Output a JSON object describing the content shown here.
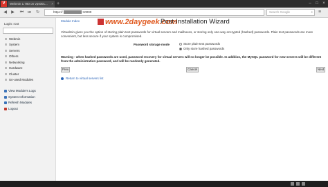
{
  "browser": {
    "tab_title": "Webmin 1.780 on vps001...",
    "tab_close": "×",
    "new_tab": "+",
    "address_prefix": "https://",
    "address_suffix": ":10000",
    "search_placeholder": "Search Google",
    "min_label": "–",
    "max_label": "□",
    "close_label": "×"
  },
  "sidebar": {
    "login": "Login: root",
    "nav": [
      "Webmin",
      "System",
      "Servers",
      "Others",
      "Networking",
      "Hardware",
      "Cluster",
      "Un-used Modules"
    ],
    "actions": [
      {
        "label": "View Module's Logs",
        "color": "#3b73b9"
      },
      {
        "label": "System Information",
        "color": "#3b73b9"
      },
      {
        "label": "Refresh Modules",
        "color": "#3b73b9"
      },
      {
        "label": "Logout",
        "color": "#c0392b"
      }
    ]
  },
  "main": {
    "module_index": "Module Index",
    "watermark": "www.2daygeek.com",
    "title": "Post-Installation Wizard",
    "intro": "Virtualmin gives you the option of storing plain-text passwords for virtual servers and mailboxes, or storing only one-way encrypted (hashed) passwords. Plain text passwords are more convenient, but less secure if your system is compromised.",
    "mode_label": "Password storage mode",
    "options": [
      {
        "label": "Store plain-text passwords",
        "selected": false
      },
      {
        "label": "Only store hashed passwords",
        "selected": true
      }
    ],
    "warning": "Warning - when hashed passwords are used, password recovery for virtual servers will no longer be possible. In addition, the MySQL password for new servers will be different from the administration password, and will be randomly generated.",
    "buttons": {
      "prev": "Prev",
      "cancel": "Cancel",
      "next": "Next"
    },
    "return_link": "Return to virtual servers list"
  }
}
